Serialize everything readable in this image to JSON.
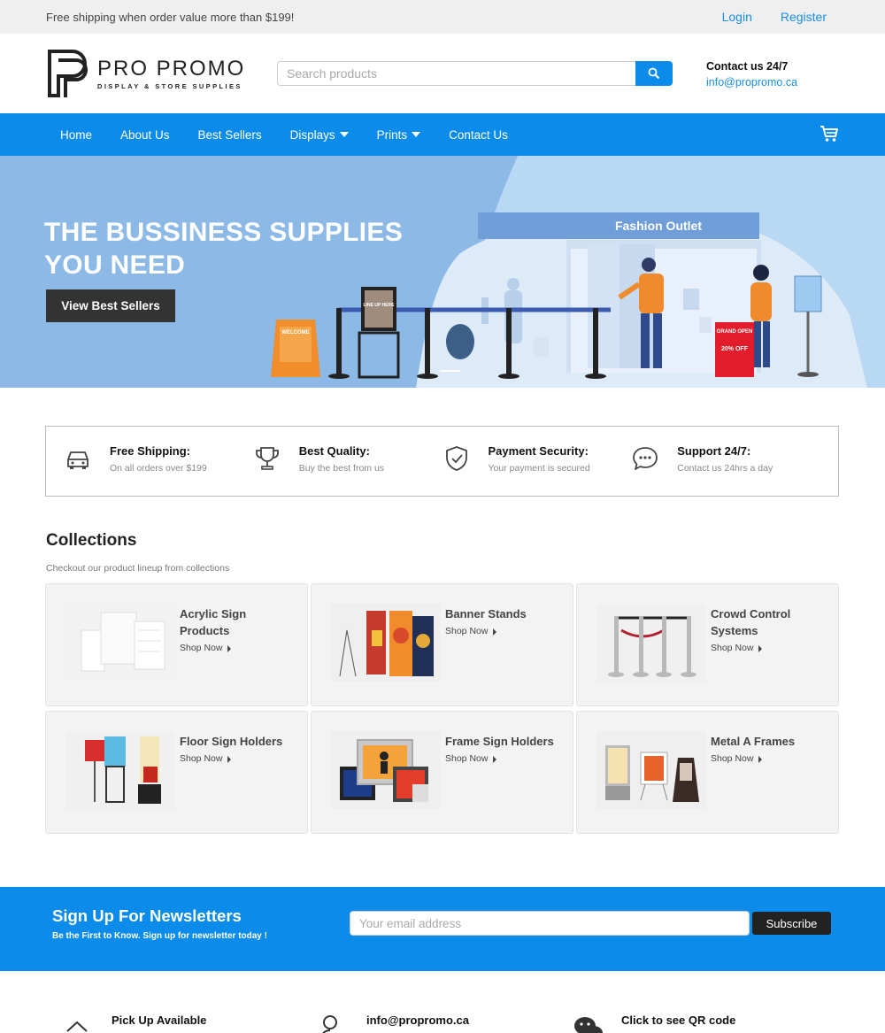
{
  "topbar": {
    "promo": "Free shipping when order value more than $199!",
    "login": "Login",
    "register": "Register"
  },
  "header": {
    "brand": "PRO PROMO",
    "tagline": "DISPLAY & STORE SUPPLIES",
    "search_placeholder": "Search products",
    "contact_title": "Contact us 24/7",
    "contact_email": "info@propromo.ca"
  },
  "nav": {
    "items": [
      {
        "label": "Home",
        "dropdown": false
      },
      {
        "label": "About Us",
        "dropdown": false
      },
      {
        "label": "Best Sellers",
        "dropdown": false
      },
      {
        "label": "Displays",
        "dropdown": true
      },
      {
        "label": "Prints",
        "dropdown": true
      },
      {
        "label": "Contact Us",
        "dropdown": false
      }
    ],
    "cart_icon": "cart-icon"
  },
  "hero": {
    "title_line1": "THE BUSSINESS SUPPLIES",
    "title_line2": "YOU NEED",
    "button": "View Best Sellers",
    "store_sign": "Fashion Outlet",
    "sign_welcome": "WELCOME",
    "sign_lineup": "LINE UP HERE",
    "sign_grand_open": "GRAND OPEN",
    "sign_discount": "20% OFF"
  },
  "features": [
    {
      "icon": "car-icon",
      "title": "Free Shipping:",
      "subtitle": "On all orders over $199"
    },
    {
      "icon": "trophy-icon",
      "title": "Best Quality:",
      "subtitle": "Buy the best from us"
    },
    {
      "icon": "shield-check-icon",
      "title": "Payment Security:",
      "subtitle": "Your payment is secured"
    },
    {
      "icon": "chat-icon",
      "title": "Support 24/7:",
      "subtitle": "Contact us 24hrs a day"
    }
  ],
  "collections": {
    "title": "Collections",
    "subtitle": "Checkout our product lineup from collections",
    "shop_label": "Shop Now",
    "items": [
      {
        "name": "Acrylic Sign Products"
      },
      {
        "name": "Banner Stands"
      },
      {
        "name": "Crowd Control Systems"
      },
      {
        "name": "Floor Sign Holders"
      },
      {
        "name": "Frame Sign Holders"
      },
      {
        "name": "Metal A Frames"
      }
    ]
  },
  "newsletter": {
    "title": "Sign Up For Newsletters",
    "subtitle": "Be the First to Know. Sign up for newsletter today !",
    "placeholder": "Your email address",
    "button": "Subscribe"
  },
  "footer": {
    "items": [
      {
        "icon": "pickup-icon",
        "label": "Pick Up Available"
      },
      {
        "icon": "user-search-icon",
        "label": "info@propromo.ca"
      },
      {
        "icon": "wechat-icon",
        "label": "Click to see QR code"
      }
    ]
  },
  "colors": {
    "accent": "#0c8cea",
    "link": "#1a8fe3",
    "dark_button": "#333333"
  }
}
